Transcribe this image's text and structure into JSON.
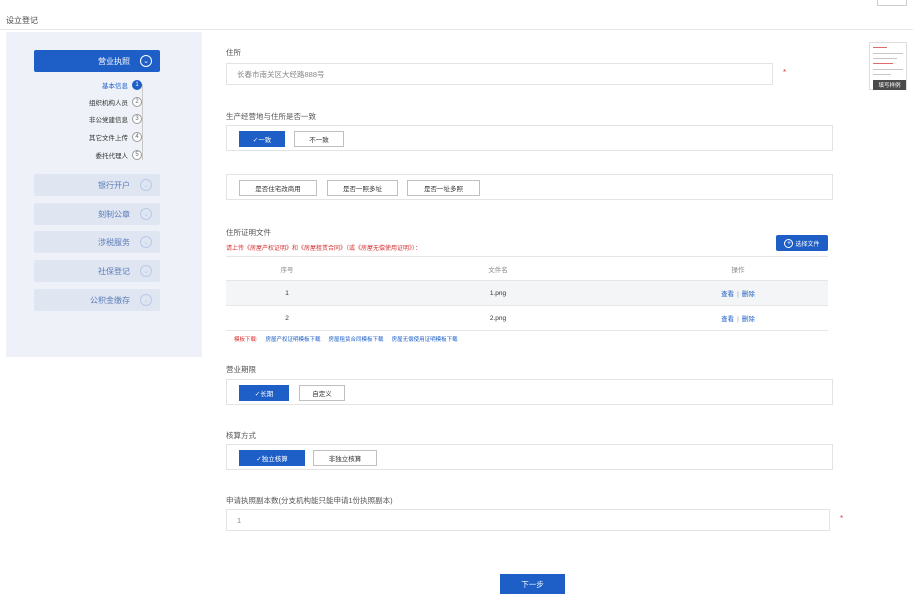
{
  "page_title": "设立登记",
  "sidebar": {
    "items": [
      {
        "label": "营业执照",
        "state": "active"
      },
      {
        "label": "银行开户",
        "state": "inactive"
      },
      {
        "label": "刻制公章",
        "state": "inactive"
      },
      {
        "label": "涉税服务",
        "state": "inactive"
      },
      {
        "label": "社保登记",
        "state": "inactive"
      },
      {
        "label": "公积金缴存",
        "state": "inactive"
      }
    ],
    "steps": [
      {
        "label": "基本信息",
        "num": "1",
        "current": true
      },
      {
        "label": "组织机构人员",
        "num": "2",
        "current": false
      },
      {
        "label": "非公党建信息",
        "num": "3",
        "current": false
      },
      {
        "label": "其它文件上传",
        "num": "4",
        "current": false
      },
      {
        "label": "委托代理人",
        "num": "5",
        "current": false
      }
    ]
  },
  "form": {
    "address_label": "住所",
    "address_value": "长春市南关区大经路888号",
    "same_label": "生产经营地与住所是否一致",
    "same_options": [
      "✓一致",
      "不一致"
    ],
    "property_options": [
      "是否住宅改商用",
      "是否一照多址",
      "是否一址多照"
    ],
    "proof_label": "住所证明文件",
    "proof_hint": "请上传《房屋产权证明》和《房屋租赁合同》（或《房屋无偿使用证明》）：",
    "upload_button": "选择文件",
    "table": {
      "headers": [
        "序号",
        "文件名",
        "操作"
      ],
      "rows": [
        {
          "no": "1",
          "name": "1.png",
          "view": "查看",
          "del": "删除"
        },
        {
          "no": "2",
          "name": "2.png",
          "view": "查看",
          "del": "删除"
        }
      ]
    },
    "templates_label": "模板下载:",
    "templates": [
      "房屋产权证明模板下载",
      "房屋租赁合同模板下载",
      "房屋无偿使用证明模板下载"
    ],
    "term_label": "营业期限",
    "term_options": [
      "✓长期",
      "自定义"
    ],
    "accounting_label": "核算方式",
    "accounting_options": [
      "✓独立核算",
      "非独立核算"
    ],
    "copies_label": "申请执照副本数(分支机构能只能申请1份执照副本)",
    "copies_value": "1",
    "required_mark": "*",
    "next_button": "下一步"
  },
  "thumbnail": {
    "caption": "填写样例"
  },
  "colors": {
    "primary": "#1d5ec7",
    "required": "#e23a3a",
    "sidebar_bg": "#eef2f8"
  }
}
